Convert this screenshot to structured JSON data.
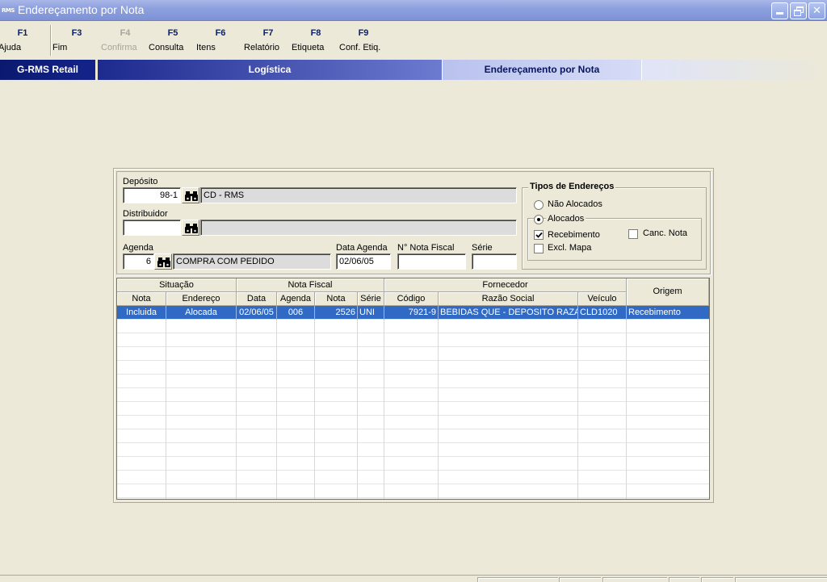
{
  "window": {
    "app_icon_text": "RMS",
    "title": "Endereçamento por Nota"
  },
  "toolbar": {
    "keys": [
      {
        "key": "F1",
        "label": "Ajuda",
        "enabled": true
      },
      {
        "key": "F3",
        "label": "Fim",
        "enabled": true
      },
      {
        "key": "F4",
        "label": "Confirma",
        "enabled": false
      },
      {
        "key": "F5",
        "label": "Consulta",
        "enabled": true
      },
      {
        "key": "F6",
        "label": "Itens",
        "enabled": true
      },
      {
        "key": "F7",
        "label": "Relatório",
        "enabled": true
      },
      {
        "key": "F8",
        "label": "Etiqueta",
        "enabled": true
      },
      {
        "key": "F9",
        "label": "Conf. Etiq.",
        "enabled": true
      }
    ]
  },
  "breadcrumb": {
    "app": "G-RMS Retail",
    "module": "Logística",
    "page": "Endereçamento por Nota"
  },
  "form": {
    "deposito": {
      "label": "Depósito",
      "code": "98-1",
      "description": "CD - RMS"
    },
    "distribuidor": {
      "label": "Distribuidor",
      "code": "",
      "description": ""
    },
    "agenda": {
      "label": "Agenda",
      "code": "6",
      "description": "COMPRA COM PEDIDO"
    },
    "data_agenda": {
      "label": "Data Agenda",
      "value": "02/06/05"
    },
    "nota_fiscal": {
      "label": "N° Nota Fiscal",
      "value": ""
    },
    "serie": {
      "label": "Série",
      "value": ""
    }
  },
  "tipos": {
    "title": "Tipos de Endereços",
    "nao_alocados": {
      "label": "Não Alocados",
      "selected": false
    },
    "alocados": {
      "label": "Alocados",
      "selected": true
    },
    "recebimento": {
      "label": "Recebimento",
      "checked": true
    },
    "canc_nota": {
      "label": "Canc. Nota",
      "checked": false
    },
    "excl_mapa": {
      "label": "Excl. Mapa",
      "checked": false
    }
  },
  "grid": {
    "groups": {
      "situacao": "Situação",
      "nota_fiscal": "Nota Fiscal",
      "fornecedor": "Fornecedor",
      "origem": "Origem"
    },
    "columns": {
      "nota": "Nota",
      "endereco": "Endereço",
      "data": "Data",
      "agenda": "Agenda",
      "nf_nota": "Nota",
      "serie": "Série",
      "codigo": "Código",
      "razao": "Razão Social",
      "veiculo": "Veículo"
    },
    "rows": [
      {
        "nota": "Incluida",
        "endereco": "Alocada",
        "data": "02/06/05",
        "agenda": "006",
        "nf_nota": "2526",
        "serie": "UNI",
        "codigo": "7921-9",
        "razao": "BEBIDAS QUE - DEPOSITO RAZAO",
        "veiculo": "CLD1020",
        "origem": "Recebimento"
      }
    ]
  },
  "colors": {
    "selection": "#316ac5",
    "title_bar": "#8ea0de",
    "brand_dark": "#0b1a6e"
  }
}
